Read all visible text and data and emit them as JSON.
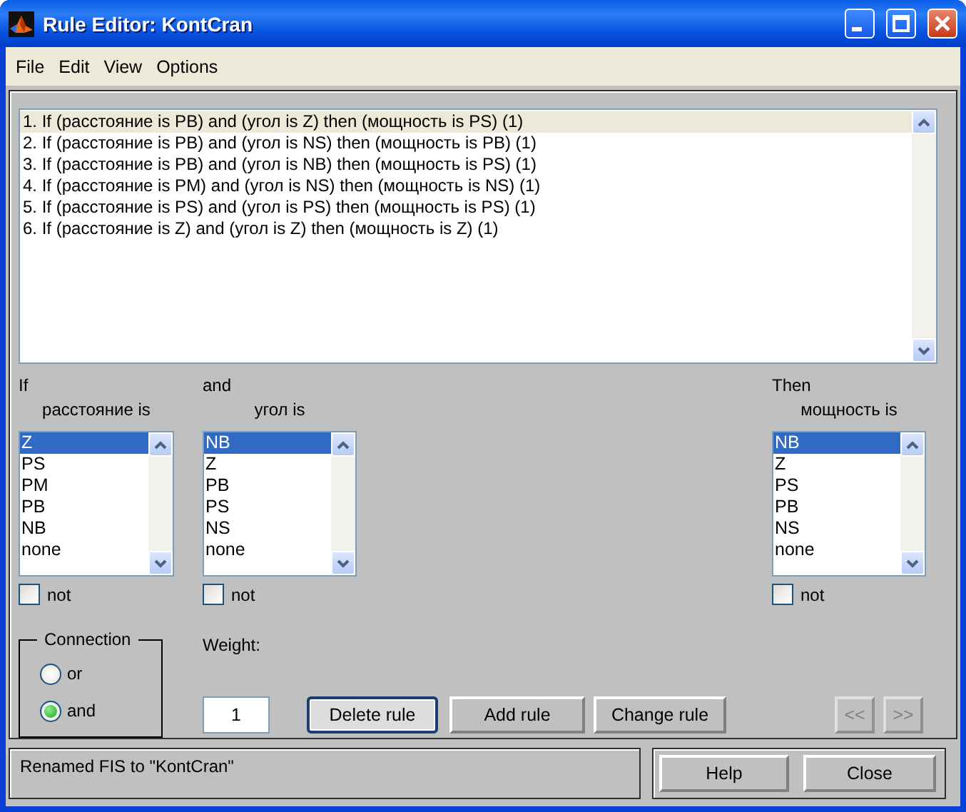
{
  "window": {
    "title": "Rule Editor: KontCran"
  },
  "menu": [
    "File",
    "Edit",
    "View",
    "Options"
  ],
  "rules": [
    {
      "text": "1. If (расстояние is PB) and (угол is Z) then (мощность is PS) (1)",
      "selected": true
    },
    {
      "text": "2. If (расстояние is PB) and (угол is NS) then (мощность is PB) (1)",
      "selected": false
    },
    {
      "text": "3. If (расстояние is PB) and (угол is NB) then (мощность is PS) (1)",
      "selected": false
    },
    {
      "text": "4. If (расстояние is PM) and (угол is NS) then (мощность is NS) (1)",
      "selected": false
    },
    {
      "text": "5. If (расстояние is PS) and (угол is PS) then (мощность is PS) (1)",
      "selected": false
    },
    {
      "text": "6. If (расстояние is Z) and (угол is Z) then (мощность is Z) (1)",
      "selected": false
    }
  ],
  "inputs": [
    {
      "heading": "If",
      "variable": "расстояние is",
      "not_label": "not",
      "not": false,
      "items": [
        {
          "label": "Z",
          "selected": true
        },
        {
          "label": "PS",
          "selected": false
        },
        {
          "label": "PM",
          "selected": false
        },
        {
          "label": "PB",
          "selected": false
        },
        {
          "label": "NB",
          "selected": false
        },
        {
          "label": "none",
          "selected": false
        }
      ]
    },
    {
      "heading": "and",
      "variable": "угол is",
      "not_label": "not",
      "not": false,
      "items": [
        {
          "label": "NB",
          "selected": true
        },
        {
          "label": "Z",
          "selected": false
        },
        {
          "label": "PB",
          "selected": false
        },
        {
          "label": "PS",
          "selected": false
        },
        {
          "label": "NS",
          "selected": false
        },
        {
          "label": "none",
          "selected": false
        }
      ]
    }
  ],
  "output": {
    "heading": "Then",
    "variable": "мощность is",
    "not_label": "not",
    "not": false,
    "items": [
      {
        "label": "NB",
        "selected": true
      },
      {
        "label": "Z",
        "selected": false
      },
      {
        "label": "PS",
        "selected": false
      },
      {
        "label": "PB",
        "selected": false
      },
      {
        "label": "NS",
        "selected": false
      },
      {
        "label": "none",
        "selected": false
      }
    ]
  },
  "connection": {
    "title": "Connection",
    "options": [
      {
        "label": "or",
        "selected": false
      },
      {
        "label": "and",
        "selected": true
      }
    ]
  },
  "weight": {
    "label": "Weight:",
    "value": "1"
  },
  "buttons": [
    {
      "label": "Delete rule",
      "focused": true
    },
    {
      "label": "Add rule",
      "focused": false
    },
    {
      "label": "Change rule",
      "focused": false
    }
  ],
  "nav": [
    {
      "label": "<<",
      "disabled": true
    },
    {
      "label": ">>",
      "disabled": true
    }
  ],
  "status": "Renamed FIS to \"KontCran\"",
  "footer_buttons": [
    "Help",
    "Close"
  ]
}
